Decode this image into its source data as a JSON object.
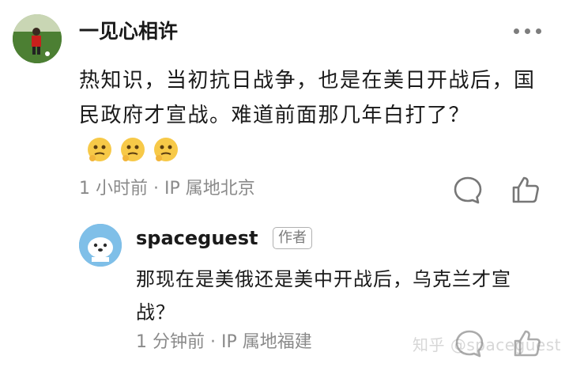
{
  "main_comment": {
    "username": "一见心相许",
    "text": "热知识，当初抗日战争，也是在美日开战后，国民政府才宣战。难道前面那几年白打了？",
    "emoji_name": "thinking-emoji",
    "emoji_count": 3,
    "meta": "1 小时前 · IP 属地北京"
  },
  "reply": {
    "username": "spaceguest",
    "badge": "作者",
    "text": "那现在是美俄还是美中开战后，乌克兰才宣战？",
    "meta": "1 分钟前 · IP 属地福建"
  },
  "watermark": "知乎 @spaceguest",
  "colors": {
    "text": "#1a1a1a",
    "meta": "#8a8a8a",
    "icon": "#777777",
    "emoji": "#f7c948"
  }
}
